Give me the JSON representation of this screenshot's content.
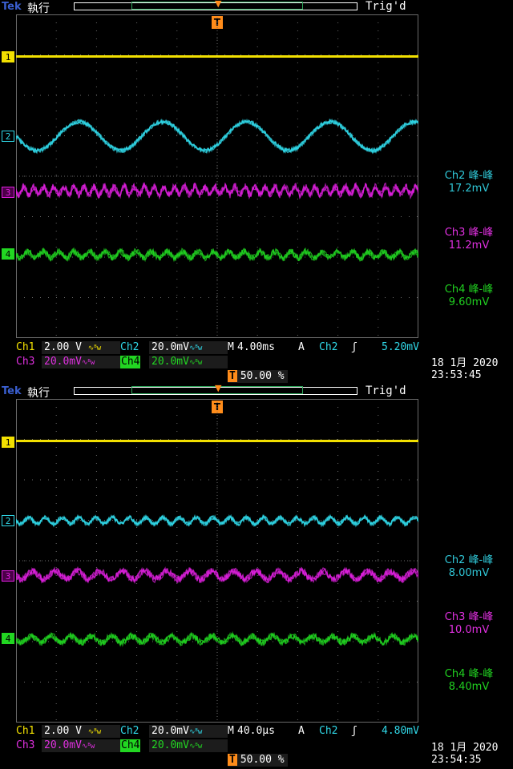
{
  "colors": {
    "ch1": "#f2e000",
    "ch2": "#30d8e8",
    "ch3": "#e020e0",
    "ch4": "#22d622",
    "trigger": "#ff8c1a",
    "grid": "#6a6a6a"
  },
  "icons": {
    "trigger_marker": "T-orange-badge",
    "edge": "rising-edge-icon",
    "coupling": "ac-coupling-bw-icon"
  },
  "screens": [
    {
      "tek": "Tek",
      "run": "執行",
      "trig": "Trig'd",
      "trig_marker": "T",
      "channels": {
        "ch1": "1",
        "ch2": "2",
        "ch3": "3",
        "ch4": "4"
      },
      "measurements": [
        {
          "label": "Ch2 峰-峰",
          "value": "17.2mV"
        },
        {
          "label": "Ch3 峰-峰",
          "value": "11.2mV"
        },
        {
          "label": "Ch4 峰-峰",
          "value": "9.60mV"
        }
      ],
      "status": {
        "ch1_label": "Ch1",
        "ch1_scale": "2.00 V",
        "ch2_label": "Ch2",
        "ch2_scale": "20.0mV",
        "ch3_label": "Ch3",
        "ch3_scale": "20.0mV",
        "ch4_label": "Ch4",
        "ch4_scale": "20.0mV",
        "coupling": "∿ᴮw",
        "m_label": "M",
        "timebase": "4.00ms",
        "trig_mode": "A",
        "trig_src": "Ch2",
        "trig_edge": "ʃ",
        "trig_level": "5.20mV",
        "trig_pos_badge": "T",
        "trig_pos": "50.00 %"
      },
      "timestamp": {
        "date": "18 1月  2020",
        "time": "23:53:45"
      },
      "wave": {
        "ch2_cycles": 4.8,
        "ch2_amp": 0.36,
        "ch3_cycles": 40,
        "ch4_cycles": 26
      }
    },
    {
      "tek": "Tek",
      "run": "執行",
      "trig": "Trig'd",
      "trig_marker": "T",
      "channels": {
        "ch1": "1",
        "ch2": "2",
        "ch3": "3",
        "ch4": "4"
      },
      "measurements": [
        {
          "label": "Ch2 峰-峰",
          "value": "8.00mV"
        },
        {
          "label": "Ch3 峰-峰",
          "value": "10.0mV"
        },
        {
          "label": "Ch4 峰-峰",
          "value": "8.40mV"
        }
      ],
      "status": {
        "ch1_label": "Ch1",
        "ch1_scale": "2.00 V",
        "ch2_label": "Ch2",
        "ch2_scale": "20.0mV",
        "ch3_label": "Ch3",
        "ch3_scale": "20.0mV",
        "ch4_label": "Ch4",
        "ch4_scale": "20.0mV",
        "coupling": "∿ᴮw",
        "m_label": "M",
        "timebase": "40.0µs",
        "trig_mode": "A",
        "trig_src": "Ch2",
        "trig_edge": "ʃ",
        "trig_level": "4.80mV",
        "trig_pos_badge": "T",
        "trig_pos": "50.00 %"
      },
      "timestamp": {
        "date": "18 1月  2020",
        "time": "23:54:35"
      },
      "wave": {
        "ch2_cycles": 24,
        "ch2_amp": 0.08,
        "ch3_cycles": 18,
        "ch4_cycles": 20
      }
    }
  ]
}
